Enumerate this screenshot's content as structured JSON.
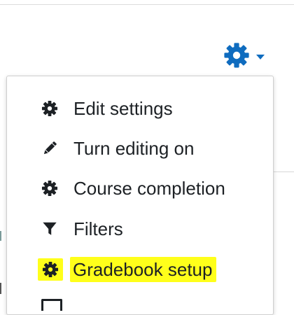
{
  "actions_menu": {
    "toggle": {
      "icon": "gear-icon",
      "caret_icon": "caret-down-icon",
      "color": "#0f6cbf"
    },
    "items": [
      {
        "label": "Edit settings",
        "icon": "gear-icon"
      },
      {
        "label": "Turn editing on",
        "icon": "pencil-icon"
      },
      {
        "label": "Course completion",
        "icon": "gear-icon"
      },
      {
        "label": "Filters",
        "icon": "filter-icon"
      },
      {
        "label": "Gradebook setup",
        "icon": "gear-icon",
        "highlighted": true,
        "highlight_color": "#ffff1a"
      }
    ],
    "partial_next_item": {
      "icon": "table-icon"
    }
  }
}
